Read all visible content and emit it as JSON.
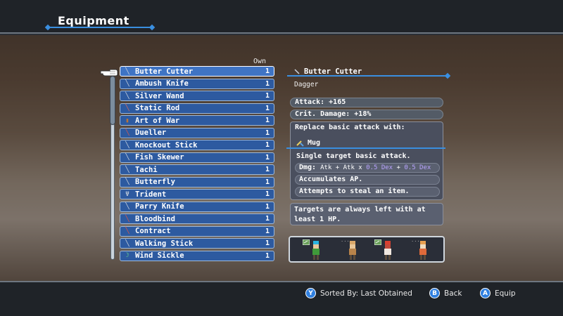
{
  "header": {
    "title": "Equipment"
  },
  "list": {
    "own_header": "Own",
    "items": [
      {
        "name": "Butter Cutter",
        "qty": "1",
        "icon": "dagger-icon"
      },
      {
        "name": "Ambush Knife",
        "qty": "1",
        "icon": "dagger-icon"
      },
      {
        "name": "Silver Wand",
        "qty": "1",
        "icon": "wand-icon"
      },
      {
        "name": "Static Rod",
        "qty": "1",
        "icon": "rod-icon"
      },
      {
        "name": "Art of War",
        "qty": "1",
        "icon": "book-icon"
      },
      {
        "name": "Dueller",
        "qty": "1",
        "icon": "sword-icon"
      },
      {
        "name": "Knockout Stick",
        "qty": "1",
        "icon": "staff-icon"
      },
      {
        "name": "Fish Skewer",
        "qty": "1",
        "icon": "spear-icon"
      },
      {
        "name": "Tachi",
        "qty": "1",
        "icon": "katana-icon"
      },
      {
        "name": "Butterfly",
        "qty": "1",
        "icon": "dagger-icon"
      },
      {
        "name": "Trident",
        "qty": "1",
        "icon": "trident-icon"
      },
      {
        "name": "Parry Knife",
        "qty": "1",
        "icon": "dagger-icon"
      },
      {
        "name": "Bloodbind",
        "qty": "1",
        "icon": "sword-icon"
      },
      {
        "name": "Contract",
        "qty": "1",
        "icon": "sword-icon"
      },
      {
        "name": "Walking Stick",
        "qty": "1",
        "icon": "staff-icon"
      },
      {
        "name": "Wind Sickle",
        "qty": "1",
        "icon": "sickle-icon"
      }
    ]
  },
  "detail": {
    "name": "Butter Cutter",
    "type": "Dagger",
    "attack": "Attack:  +165",
    "crit": "Crit. Damage:  +18%",
    "ability_header": "Replace basic attack with:",
    "ability_name": "Mug",
    "ability_desc": "Single target basic attack.",
    "dmg_label": "Dmg:",
    "dmg_part1": "Atk + Atk x ",
    "dmg_part2": "0.5 Dex",
    "dmg_part3": " + ",
    "dmg_part4": "0.5 Dex",
    "ap": "Accumulates AP.",
    "steal": "Attempts to steal an item.",
    "note": "Targets are always left with at least 1 HP."
  },
  "party": {
    "members": [
      {
        "name": "blue-hair-hero",
        "equippable": true,
        "colors": [
          "#2bb3e0",
          "#3f9a3a",
          "#e8c79a"
        ]
      },
      {
        "name": "bald-monk",
        "equippable": false,
        "colors": [
          "#d9a86a",
          "#b8834a",
          "#e8c79a"
        ]
      },
      {
        "name": "red-mage",
        "equippable": true,
        "colors": [
          "#d94030",
          "#f0e8e0",
          "#c04a3a"
        ]
      },
      {
        "name": "orange-fighter",
        "equippable": false,
        "colors": [
          "#e8a050",
          "#e06a3a",
          "#f0dcc0"
        ]
      }
    ]
  },
  "footer": {
    "sort_button": "Y",
    "sort_label": "Sorted By: Last Obtained",
    "back_button": "B",
    "back_label": "Back",
    "equip_button": "A",
    "equip_label": "Equip"
  },
  "colors": {
    "row_bg": "#2d5aa0",
    "accent_line": "#3a8fe0",
    "button": "#2f7fe0"
  }
}
